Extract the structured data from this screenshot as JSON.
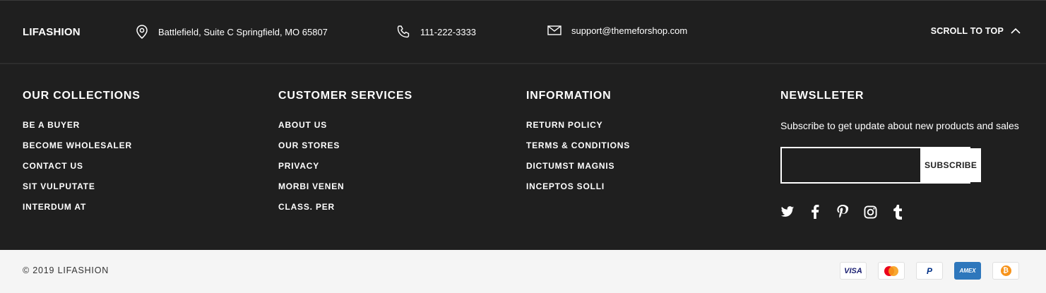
{
  "topbar": {
    "brand": "LIFASHION",
    "address": "Battlefield, Suite C Springfield, MO 65807",
    "phone": "111-222-3333",
    "email": "support@themeforshop.com",
    "scroll_top": "SCROLL TO TOP"
  },
  "columns": [
    {
      "title": "OUR COLLECTIONS",
      "items": [
        "BE A BUYER",
        "BECOME WHOLESALER",
        "CONTACT US",
        "SIT VULPUTATE",
        "INTERDUM AT"
      ]
    },
    {
      "title": "CUSTOMER SERVICES",
      "items": [
        "ABOUT US",
        "OUR STORES",
        "PRIVACY",
        "MORBI VENEN",
        "CLASS. PER"
      ]
    },
    {
      "title": "INFORMATION",
      "items": [
        "RETURN POLICY",
        "TERMS & CONDITIONS",
        "DICTUMST MAGNIS",
        "INCEPTOS SOLLI"
      ]
    }
  ],
  "newsletter": {
    "title": "NEWSLLETER",
    "desc": "Subscribe to get update about new products and sales",
    "input_value": "",
    "button": "SUBSCRIBE",
    "socials": [
      "twitter-icon",
      "facebook-icon",
      "pinterest-icon",
      "instagram-icon",
      "tumblr-icon"
    ]
  },
  "bottom": {
    "copyright": "© 2019 LIFASHION",
    "payments": {
      "visa": "VISA",
      "mastercard": "mastercard-icon",
      "paypal": "P",
      "amex": "AMEX",
      "bitcoin": "₿"
    }
  },
  "colors": {
    "background": "#1f1f1f",
    "bottom_bar": "#f5f5f5",
    "text": "#ffffff"
  }
}
